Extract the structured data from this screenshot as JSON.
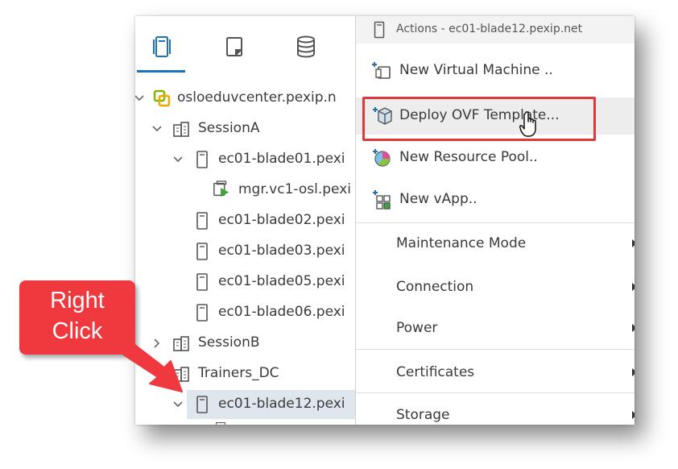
{
  "navigator": {
    "tabs": [
      {
        "name": "hosts-and-clusters",
        "selected": true
      },
      {
        "name": "vms-and-templates",
        "selected": false
      },
      {
        "name": "storage",
        "selected": false
      }
    ]
  },
  "tree": {
    "items": [
      {
        "label": "osloeduvcenter.pexip.n",
        "icon": "vcenter-icon",
        "expanded": true
      },
      {
        "label": "SessionA",
        "icon": "datacenter-icon",
        "expanded": true
      },
      {
        "label": "ec01-blade01.pexi",
        "icon": "host-icon",
        "expanded": true
      },
      {
        "label": "mgr.vc1-osl.pexi",
        "icon": "vm-icon"
      },
      {
        "label": "ec01-blade02.pexi",
        "icon": "host-icon"
      },
      {
        "label": "ec01-blade03.pexi",
        "icon": "host-icon"
      },
      {
        "label": "ec01-blade05.pexi",
        "icon": "host-icon"
      },
      {
        "label": "ec01-blade06.pexi",
        "icon": "host-icon"
      },
      {
        "label": "SessionB",
        "icon": "datacenter-icon",
        "expanded": false
      },
      {
        "label": "Trainers_DC",
        "icon": "datacenter-icon"
      },
      {
        "label": "ec01-blade12.pexi",
        "icon": "host-icon",
        "expanded": true,
        "selected": true
      }
    ]
  },
  "context_menu": {
    "title": "Actions - ec01-blade12.pexip.net",
    "items": [
      {
        "label": "New Virtual Machine ..",
        "icon": "new-vm-icon"
      },
      {
        "label": "Deploy OVF Template...",
        "icon": "deploy-ovf-icon",
        "highlighted": true
      },
      {
        "label": "New Resource Pool..",
        "icon": "resource-pool-icon"
      },
      {
        "label": "New vApp..",
        "icon": "vapp-icon"
      },
      {
        "label": "Maintenance Mode",
        "submenu": true
      },
      {
        "label": "Connection",
        "submenu": true
      },
      {
        "label": "Power",
        "submenu": true
      },
      {
        "label": "Certificates",
        "submenu": true
      },
      {
        "label": "Storage",
        "submenu": true
      }
    ]
  },
  "callout": {
    "text_line1": "Right",
    "text_line2": "Click",
    "color": "#f0393e"
  },
  "colors": {
    "highlight": "#e0393b",
    "accent": "#1b72b8",
    "selected_row": "#dfe6ee"
  }
}
